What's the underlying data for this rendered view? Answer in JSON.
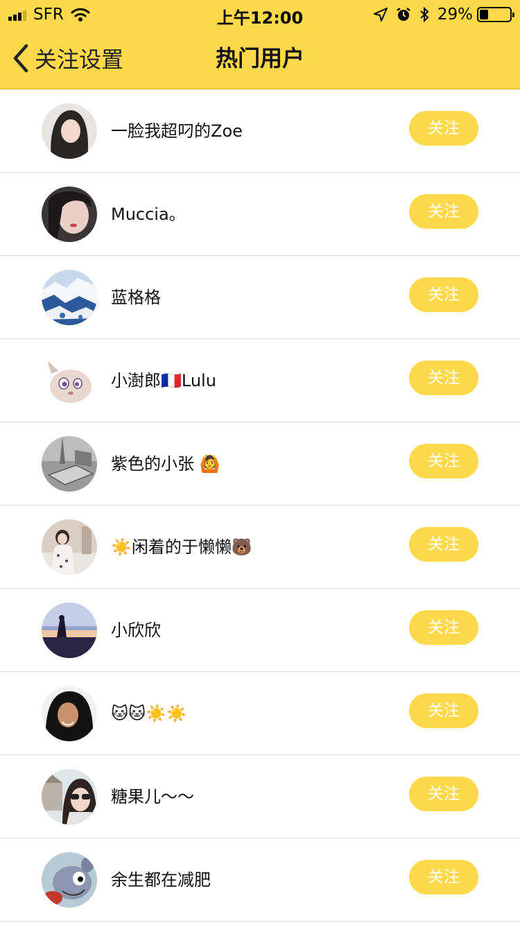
{
  "status_bar": {
    "carrier": "SFR",
    "time": "上午12:00",
    "battery_percent": "29%",
    "battery_level": 0.29,
    "icons": [
      "signal-icon",
      "wifi-icon",
      "location-arrow-icon",
      "alarm-icon",
      "bluetooth-icon",
      "battery-icon"
    ]
  },
  "nav": {
    "back_label": "关注设置",
    "title": "热门用户"
  },
  "colors": {
    "accent": "#fcd84a",
    "button_text": "#ffffff",
    "divider": "#d9d9d9"
  },
  "users": [
    {
      "name": "一脸我超叼的Zoe",
      "follow_label": "关注"
    },
    {
      "name": "Muccia。",
      "follow_label": "关注"
    },
    {
      "name": "蓝格格",
      "follow_label": "关注"
    },
    {
      "name": "小澍郎🇫🇷Lulu",
      "follow_label": "关注"
    },
    {
      "name": "紫色的小张 🙆",
      "follow_label": "关注"
    },
    {
      "name": "☀️闲着的于懒懒🐻",
      "follow_label": "关注"
    },
    {
      "name": "小欣欣",
      "follow_label": "关注"
    },
    {
      "name": " 🐱🐱☀️☀️",
      "follow_label": "关注"
    },
    {
      "name": "糖果儿～～",
      "follow_label": "关注"
    },
    {
      "name": "余生都在减肥",
      "follow_label": "关注"
    }
  ]
}
